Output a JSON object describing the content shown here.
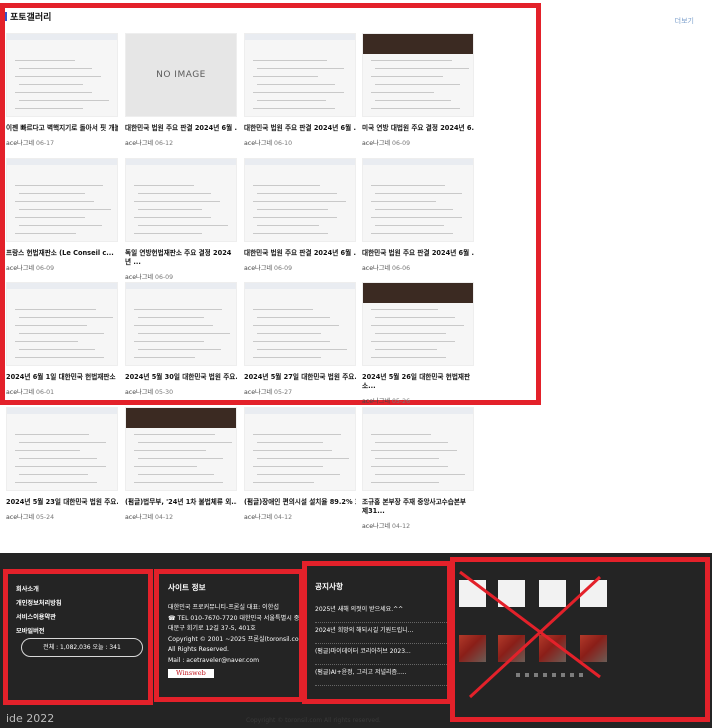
{
  "gallery": {
    "title": "포토갤러리",
    "more": "더보기",
    "no_image": "NO IMAGE",
    "items": [
      {
        "title": "이젠 빠르다고 벽핵지기로 돌아서 핏 개볼...",
        "author": "ace나그네",
        "date": "06-17"
      },
      {
        "title": "대한민국 법원 주요 판결 2024년 6월 ...",
        "author": "ace나그네",
        "date": "06-12"
      },
      {
        "title": "대한민국 법원 주요 판결 2024년 6월 ...",
        "author": "ace나그네",
        "date": "06-10"
      },
      {
        "title": "미국 연방 대법원 주요 결정 2024년 6...",
        "author": "ace나그네",
        "date": "06-09"
      },
      {
        "title": "프랑스 헌법재판소 (Le Conseil c...",
        "author": "ace나그네",
        "date": "06-09"
      },
      {
        "title": "독일 연방헌법재판소 주요 결정 2024년 ...",
        "author": "ace나그네",
        "date": "06-09"
      },
      {
        "title": "대한민국 법원 주요 판결 2024년 6월 ...",
        "author": "ace나그네",
        "date": "06-09"
      },
      {
        "title": "대한민국 법원 주요 판결 2024년 6월 ...",
        "author": "ace나그네",
        "date": "06-06"
      },
      {
        "title": "2024년 6월 1일 대한민국 헌법재판소 ...",
        "author": "ace나그네",
        "date": "06-01"
      },
      {
        "title": "2024년 5월 30일 대한민국 법원 주요...",
        "author": "ace나그네",
        "date": "05-30"
      },
      {
        "title": "2024년 5월 27일 대한민국 법원 주요...",
        "author": "ace나그네",
        "date": "05-27"
      },
      {
        "title": "2024년 5월 26일 대한민국 헌법재판소...",
        "author": "ace나그네",
        "date": "05-26"
      },
      {
        "title": "2024년 5월 23일 대한민국 법원 주요...",
        "author": "ace나그네",
        "date": "05-24"
      },
      {
        "title": "(펌글)법무부, '24년 1차 불법체류 외...",
        "author": "ace나그네",
        "date": "04-12"
      },
      {
        "title": "(펌글)장애인 편의시설 설치율 89.2% 호...",
        "author": "ace나그네",
        "date": "04-12"
      },
      {
        "title": "조규홍 본부장 주재 중앙사고수습본부 제31...",
        "author": "ace나그네",
        "date": "04-12"
      }
    ]
  },
  "footer": {
    "links": [
      "회사소개",
      "개인정보처리방침",
      "서비스이용약관",
      "모바일버전"
    ],
    "visit_counter": "전체 : 1,082,036 오늘 : 341",
    "site_info": {
      "title": "사이트 정보",
      "lines": [
        "대한민국 프로커뮤니티-프론실 대표: 이한섭",
        "☎ TEL 010-7670-7720 대한민국 서울특별시 중",
        "대문구 회기로 12길 37-5, 401호",
        "Copyright © 2001 ~2025 프론실(toronsil.com)",
        "All Rights Reserved.",
        "Mail : acetraveler@naver.com"
      ],
      "badge": "Winsweb"
    },
    "notice": {
      "title": "공지사항",
      "items": [
        "2025년 새해 의젓이 받으세요.^^",
        "2024년 희망의 해되시길 기원드립니...",
        "(펌글)마이데이터 코리아허브 2023...",
        "(펌글)AI+윤정, 그리고 저널리즘....."
      ]
    },
    "copyright_faint": "Copyright © toronsil.com All rights reserved.",
    "bottom_left": "ide 2022"
  }
}
